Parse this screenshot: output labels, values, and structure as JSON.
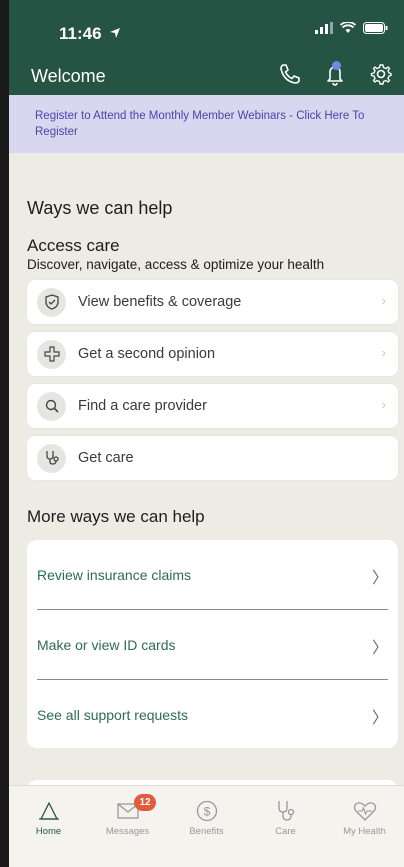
{
  "status": {
    "time": "11:46"
  },
  "header": {
    "title": "Welcome"
  },
  "banner": {
    "text": "Register to Attend the Monthly Member Webinars - Click Here To Register"
  },
  "help": {
    "heading": "Ways we can help",
    "access_title": "Access care",
    "access_subtitle": "Discover, navigate, access & optimize your health",
    "items": [
      {
        "label": "View benefits & coverage",
        "icon": "shield-check-icon"
      },
      {
        "label": "Get a second opinion",
        "icon": "cross-icon"
      },
      {
        "label": "Find a care provider",
        "icon": "search-icon"
      },
      {
        "label": "Get care",
        "icon": "stethoscope-icon"
      }
    ]
  },
  "more": {
    "heading": "More ways we can help",
    "items": [
      {
        "label": "Review insurance claims"
      },
      {
        "label": "Make or view ID cards"
      },
      {
        "label": "See all support requests"
      }
    ]
  },
  "tabs": [
    {
      "label": "Home",
      "icon": "home-icon",
      "active": true
    },
    {
      "label": "Messages",
      "icon": "envelope-icon",
      "badge": "12"
    },
    {
      "label": "Benefits",
      "icon": "dollar-icon"
    },
    {
      "label": "Care",
      "icon": "stethoscope-icon"
    },
    {
      "label": "My Health",
      "icon": "heart-icon"
    }
  ],
  "colors": {
    "primary": "#255444",
    "banner_bg": "#d9d7ef",
    "banner_text": "#4a44a8",
    "link": "#2d6b56",
    "badge": "#e15c3d"
  }
}
